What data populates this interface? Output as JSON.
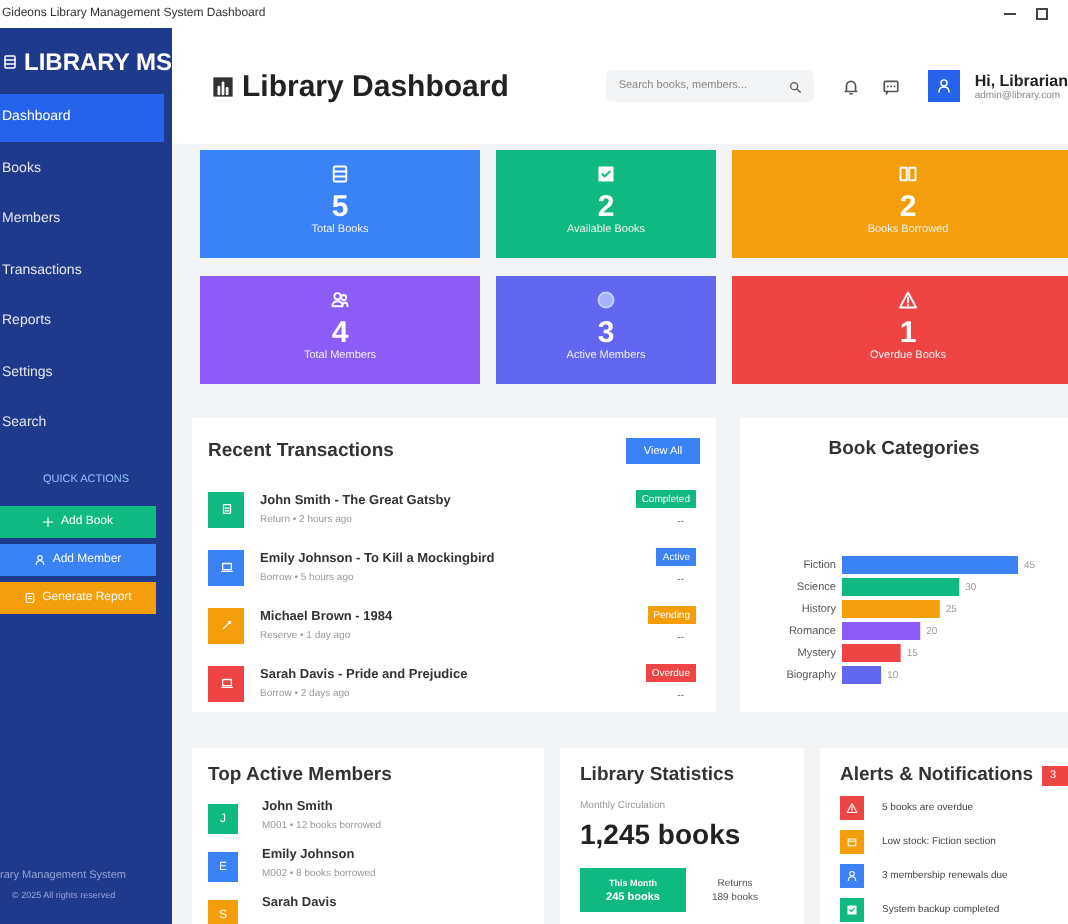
{
  "window": {
    "title": "Gideons Library Management System Dashboard"
  },
  "sidebar": {
    "brand": "LIBRARY MS",
    "items": [
      {
        "label": "Dashboard",
        "selected": true
      },
      {
        "label": "Books",
        "selected": false
      },
      {
        "label": "Members",
        "selected": false
      },
      {
        "label": "Transactions",
        "selected": false
      },
      {
        "label": "Reports",
        "selected": false
      },
      {
        "label": "Settings",
        "selected": false
      },
      {
        "label": "Search",
        "selected": false
      }
    ],
    "quick_actions_title": "QUICK ACTIONS",
    "quick_actions": [
      {
        "label": "Add Book",
        "color": "#10b981",
        "kind": "plus"
      },
      {
        "label": "Add Member",
        "color": "#3b82f6",
        "kind": "user"
      },
      {
        "label": "Generate Report",
        "color": "#f59e0b",
        "kind": "report"
      }
    ],
    "footer": [
      "rary Management System",
      "© 2025 All rights reserved"
    ]
  },
  "header": {
    "title": "Library Dashboard",
    "search": {
      "placeholder": "Search books, members..."
    },
    "user": {
      "greeting": "Hi, Librarian",
      "email": "admin@library.com"
    }
  },
  "stats": [
    {
      "value": "5",
      "label": "Total Books",
      "color": "#3b82f6",
      "kind": "books"
    },
    {
      "value": "2",
      "label": "Available Books",
      "color": "#10b981",
      "kind": "check"
    },
    {
      "value": "2",
      "label": "Books Borrowed",
      "color": "#f59e0b",
      "kind": "book"
    },
    {
      "value": "4",
      "label": "Total Members",
      "color": "#8b5cf6",
      "kind": "users"
    },
    {
      "value": "3",
      "label": "Active Members",
      "color": "#6366f1",
      "kind": "circle"
    },
    {
      "value": "1",
      "label": "Overdue Books",
      "color": "#ef4444",
      "kind": "warning"
    }
  ],
  "transactions": {
    "title": "Recent Transactions",
    "view_all": "View All",
    "items": [
      {
        "title": "John Smith - The Great Gatsby",
        "meta": "Return • 2 hours ago",
        "status": "Completed",
        "extra": "--",
        "color": "#10b981",
        "kind": "return"
      },
      {
        "title": "Emily Johnson - To Kill a Mockingbird",
        "meta": "Borrow • 5 hours ago",
        "status": "Active",
        "extra": "--",
        "color": "#3b82f6",
        "kind": "borrow"
      },
      {
        "title": "Michael Brown - 1984",
        "meta": "Reserve • 1 day ago",
        "status": "Pending",
        "extra": "--",
        "color": "#f59e0b",
        "kind": "reserve"
      },
      {
        "title": "Sarah Davis - Pride and Prejudice",
        "meta": "Borrow • 2 days ago",
        "status": "Overdue",
        "extra": "--",
        "color": "#ef4444",
        "kind": "borrow"
      }
    ]
  },
  "categories": {
    "title": "Book Categories",
    "chart_data": {
      "type": "bar",
      "orientation": "horizontal",
      "stacked": true,
      "categories": [
        "Fiction",
        "Science",
        "History",
        "Romance",
        "Mystery",
        "Biography"
      ],
      "data_labels": true,
      "series": [
        {
          "color": "#3b82f6",
          "values": [
            45,
            null,
            null,
            null,
            null,
            null
          ]
        },
        {
          "color": "#10b981",
          "values": [
            null,
            30,
            null,
            null,
            null,
            null
          ]
        },
        {
          "color": "#f59e0b",
          "values": [
            null,
            null,
            25,
            null,
            null,
            null
          ]
        },
        {
          "color": "#8b5cf6",
          "values": [
            null,
            null,
            null,
            20,
            null,
            null
          ]
        },
        {
          "color": "#ef4444",
          "values": [
            null,
            null,
            null,
            null,
            15,
            null
          ]
        },
        {
          "color": "#6366f1",
          "values": [
            null,
            null,
            null,
            null,
            null,
            10
          ]
        }
      ]
    }
  },
  "members": {
    "title": "Top Active Members",
    "items": [
      {
        "initial": "J",
        "name": "John Smith",
        "meta": "M001 • 12 books borrowed",
        "color": "#10b981"
      },
      {
        "initial": "E",
        "name": "Emily Johnson",
        "meta": "M002 • 8 books borrowed",
        "color": "#3b82f6"
      },
      {
        "initial": "S",
        "name": "Sarah Davis",
        "color": "#f59e0b"
      }
    ]
  },
  "statistics": {
    "title": "Library Statistics",
    "label": "Monthly Circulation",
    "value": "1,245 books",
    "this_month": {
      "label": "This Month",
      "value": "245 books"
    },
    "returns": {
      "label": "Returns",
      "value": "189 books"
    }
  },
  "alerts": {
    "title": "Alerts & Notifications",
    "count": "3",
    "items": [
      {
        "text": "5 books are overdue",
        "color": "#ef4444",
        "kind": "warning"
      },
      {
        "text": "Low stock: Fiction section",
        "color": "#f59e0b",
        "kind": "box"
      },
      {
        "text": "3 membership renewals due",
        "color": "#3b82f6",
        "kind": "user"
      },
      {
        "text": "System backup completed",
        "color": "#10b981",
        "kind": "check"
      }
    ]
  }
}
